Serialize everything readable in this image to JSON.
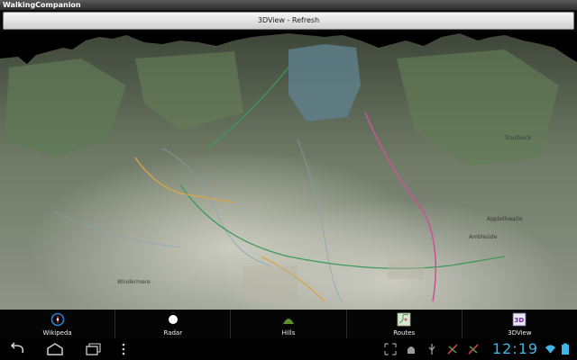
{
  "app": {
    "title": "WalkingCompanion"
  },
  "toolbar": {
    "refresh_label": "3DView - Refresh"
  },
  "tabs": [
    {
      "label": "Wikipeda",
      "icon": "compass-icon"
    },
    {
      "label": "Radar",
      "icon": "radar-dot-icon"
    },
    {
      "label": "Hills",
      "icon": "hill-icon"
    },
    {
      "label": "Routes",
      "icon": "map-routes-icon"
    },
    {
      "label": "3DView",
      "icon": "3d-view-icon"
    }
  ],
  "status_bar": {
    "time": "12:19",
    "icons": [
      "screenshot-icon",
      "android-debug-icon",
      "usb-icon",
      "location-off-icon",
      "wifi-icon",
      "battery-icon"
    ]
  },
  "map": {
    "place_labels": [
      "Ambleside",
      "Applethwaite",
      "Windermere",
      "Troutbeck"
    ]
  },
  "colors": {
    "clock": "#3fb6e8",
    "hills": "#5e8f2e",
    "compass": "#2a7fd1"
  }
}
